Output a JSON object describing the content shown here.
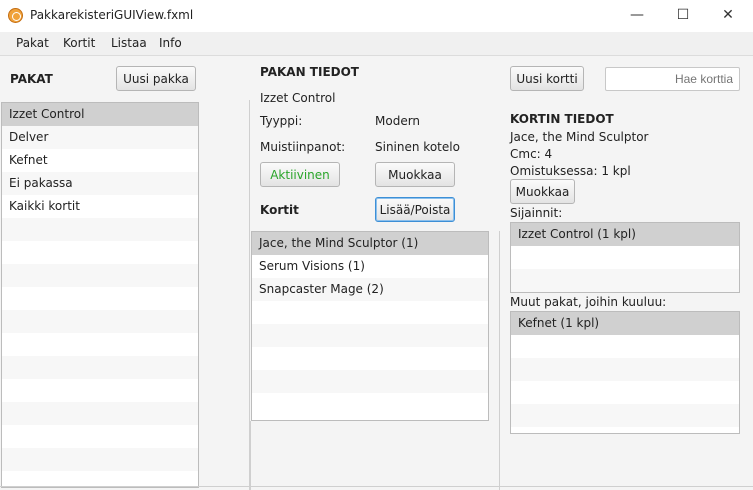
{
  "window": {
    "title": "PakkarekisteriGUIView.fxml",
    "controls": {
      "minimize": "—",
      "maximize": "☐",
      "close": "✕"
    }
  },
  "menu": [
    "Pakat",
    "Kortit",
    "Listaa",
    "Info"
  ],
  "left": {
    "heading": "PAKAT",
    "new_button": "Uusi pakka",
    "decks": [
      "Izzet Control",
      "Delver",
      "Kefnet",
      "Ei pakassa",
      "Kaikki kortit"
    ],
    "selected_index": 0
  },
  "middle": {
    "heading": "PAKAN TIEDOT",
    "deck_name": "Izzet Control",
    "type_label": "Tyyppi:",
    "type_value": "Modern",
    "notes_label": "Muistiinpanot:",
    "notes_value": "Sininen kotelo",
    "active_button": "Aktiivinen",
    "edit_button": "Muokkaa",
    "cards_label": "Kortit",
    "add_remove_button": "Lisää/Poista",
    "cards": [
      "Jace, the Mind Sculptor (1)",
      "Serum Visions (1)",
      "Snapcaster Mage (2)"
    ],
    "selected_index": 0
  },
  "right": {
    "new_card_button": "Uusi kortti",
    "search_placeholder": "Hae korttia",
    "heading": "KORTIN TIEDOT",
    "card_name": "Jace, the Mind Sculptor",
    "cmc": "Cmc: 4",
    "owned": "Omistuksessa: 1 kpl",
    "edit_button": "Muokkaa",
    "locations_label": "Sijainnit:",
    "locations": [
      "Izzet Control (1 kpl)"
    ],
    "other_decks_label": "Muut pakat, joihin kuuluu:",
    "other_decks": [
      "Kefnet (1 kpl)"
    ]
  },
  "colors": {
    "active_green": "#2aa52a",
    "focus_blue": "#3d8fd6",
    "selected_row": "#d0d0d0"
  }
}
